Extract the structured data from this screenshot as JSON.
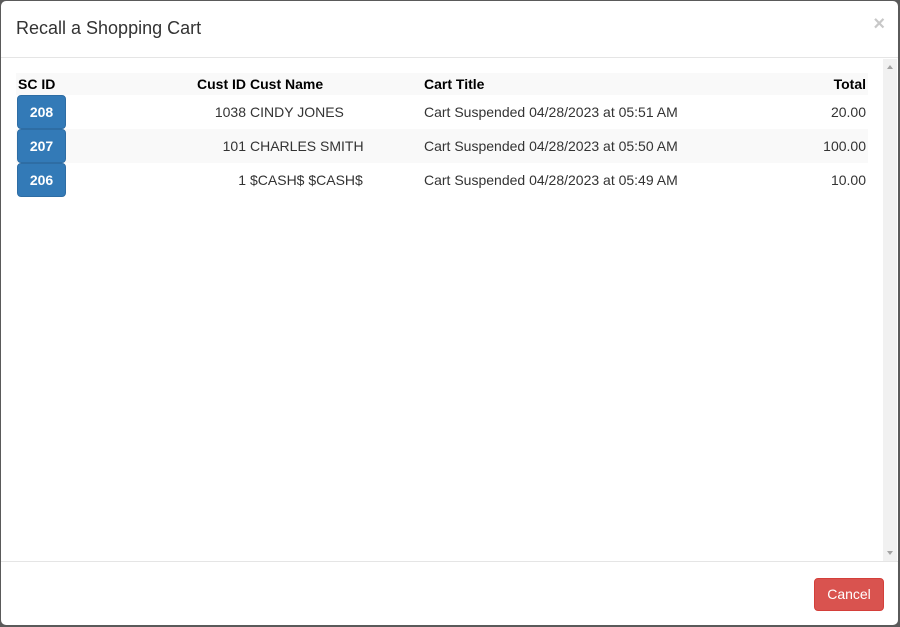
{
  "modal": {
    "title": "Recall a Shopping Cart",
    "close_glyph": "×"
  },
  "table": {
    "headers": {
      "sc_id": "SC ID",
      "cust_id": "Cust ID",
      "cust_name": "Cust Name",
      "cart_title": "Cart Title",
      "total": "Total"
    },
    "rows": [
      {
        "sc_id": "208",
        "cust_id": "1038",
        "cust_name": "CINDY JONES",
        "cart_title": "Cart Suspended 04/28/2023 at 05:51 AM",
        "total": "20.00"
      },
      {
        "sc_id": "207",
        "cust_id": "101",
        "cust_name": "CHARLES SMITH",
        "cart_title": "Cart Suspended 04/28/2023 at 05:50 AM",
        "total": "100.00"
      },
      {
        "sc_id": "206",
        "cust_id": "1",
        "cust_name": "$CASH$ $CASH$",
        "cart_title": "Cart Suspended 04/28/2023 at 05:49 AM",
        "total": "10.00"
      }
    ]
  },
  "footer": {
    "cancel_label": "Cancel"
  },
  "colors": {
    "primary": "#337ab7",
    "danger": "#d9534f",
    "stripe": "#f9f9f9"
  }
}
